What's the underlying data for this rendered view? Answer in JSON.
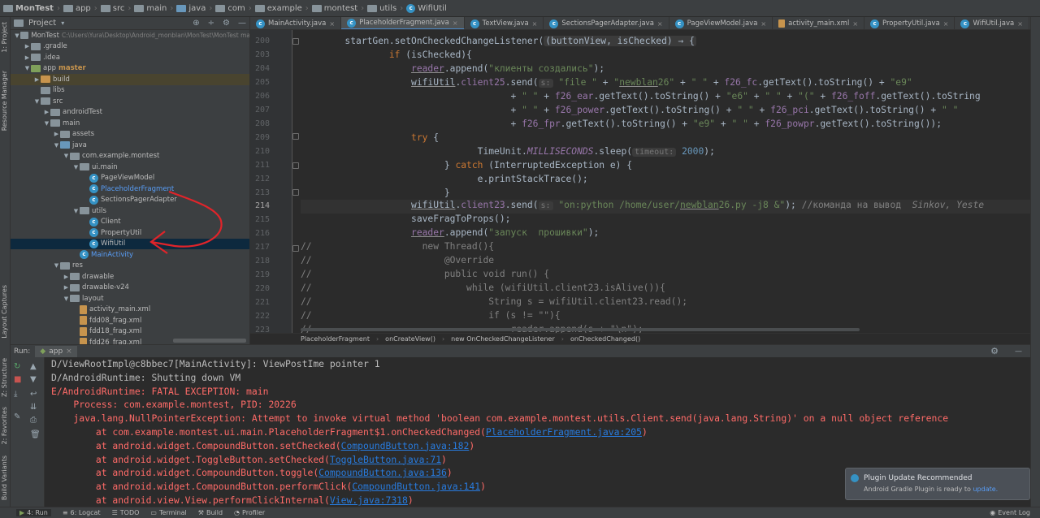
{
  "breadcrumb": [
    "MonTest",
    "app",
    "src",
    "main",
    "java",
    "com",
    "example",
    "montest",
    "utils",
    "WifiUtil"
  ],
  "project_panel": {
    "title": "Project",
    "tree": [
      {
        "label": "MonTest",
        "extra": "C:\\Users\\Yura\\Desktop\\Android_monblan\\MonTest\\MonTest  ma",
        "indent": 0,
        "icon": "folder",
        "arrow": "open"
      },
      {
        "label": ".gradle",
        "indent": 1,
        "icon": "folder",
        "arrow": "closed"
      },
      {
        "label": ".idea",
        "indent": 1,
        "icon": "folder",
        "arrow": "closed"
      },
      {
        "label": "app",
        "extra": "master",
        "indent": 1,
        "icon": "folder-green",
        "arrow": "open"
      },
      {
        "label": "build",
        "indent": 2,
        "icon": "folder-orange",
        "arrow": "closed",
        "highlight": true
      },
      {
        "label": "libs",
        "indent": 2,
        "icon": "folder",
        "arrow": "none"
      },
      {
        "label": "src",
        "indent": 2,
        "icon": "folder",
        "arrow": "open"
      },
      {
        "label": "androidTest",
        "indent": 3,
        "icon": "folder",
        "arrow": "closed"
      },
      {
        "label": "main",
        "indent": 3,
        "icon": "folder",
        "arrow": "open"
      },
      {
        "label": "assets",
        "indent": 4,
        "icon": "folder",
        "arrow": "closed"
      },
      {
        "label": "java",
        "indent": 4,
        "icon": "folder-blue",
        "arrow": "open"
      },
      {
        "label": "com.example.montest",
        "indent": 5,
        "icon": "folder",
        "arrow": "open"
      },
      {
        "label": "ui.main",
        "indent": 6,
        "icon": "folder",
        "arrow": "open"
      },
      {
        "label": "PageViewModel",
        "indent": 7,
        "icon": "class",
        "arrow": "none"
      },
      {
        "label": "PlaceholderFragment",
        "indent": 7,
        "icon": "class",
        "arrow": "none",
        "color": "blue"
      },
      {
        "label": "SectionsPagerAdapter",
        "indent": 7,
        "icon": "class",
        "arrow": "none"
      },
      {
        "label": "utils",
        "indent": 6,
        "icon": "folder",
        "arrow": "open"
      },
      {
        "label": "Client",
        "indent": 7,
        "icon": "class",
        "arrow": "none"
      },
      {
        "label": "PropertyUtil",
        "indent": 7,
        "icon": "class",
        "arrow": "none"
      },
      {
        "label": "WifiUtil",
        "indent": 7,
        "icon": "class",
        "arrow": "none",
        "selected": true
      },
      {
        "label": "MainActivity",
        "indent": 6,
        "icon": "class",
        "arrow": "none",
        "color": "blue"
      },
      {
        "label": "res",
        "indent": 4,
        "icon": "folder",
        "arrow": "open"
      },
      {
        "label": "drawable",
        "indent": 5,
        "icon": "folder",
        "arrow": "closed"
      },
      {
        "label": "drawable-v24",
        "indent": 5,
        "icon": "folder",
        "arrow": "closed"
      },
      {
        "label": "layout",
        "indent": 5,
        "icon": "folder",
        "arrow": "open"
      },
      {
        "label": "activity_main.xml",
        "indent": 6,
        "icon": "xml",
        "arrow": "none"
      },
      {
        "label": "fdd08_frag.xml",
        "indent": 6,
        "icon": "xml",
        "arrow": "none"
      },
      {
        "label": "fdd18_frag.xml",
        "indent": 6,
        "icon": "xml",
        "arrow": "none"
      },
      {
        "label": "fdd26_frag.xml",
        "indent": 6,
        "icon": "xml",
        "arrow": "none"
      }
    ]
  },
  "left_strip": [
    "1: Project",
    "Resource Manager",
    "Layout Captures",
    "Z: Structure",
    "2: Favorites",
    "Build Variants"
  ],
  "editor_tabs": [
    {
      "label": "MainActivity.java",
      "active": false
    },
    {
      "label": "PlaceholderFragment.java",
      "active": true
    },
    {
      "label": "TextView.java",
      "active": false
    },
    {
      "label": "SectionsPagerAdapter.java",
      "active": false
    },
    {
      "label": "PageViewModel.java",
      "active": false
    },
    {
      "label": "activity_main.xml",
      "active": false
    },
    {
      "label": "PropertyUtil.java",
      "active": false
    },
    {
      "label": "WifiUtil.java",
      "active": false
    },
    {
      "label": "Client.java",
      "active": false
    }
  ],
  "editor": {
    "line_numbers": [
      "199",
      "200",
      "203",
      "204",
      "205",
      "206",
      "207",
      "208",
      "209",
      "210",
      "211",
      "212",
      "213",
      "214",
      "215",
      "216",
      "217",
      "218",
      "219",
      "220",
      "221",
      "222",
      "223"
    ],
    "current_line": "214"
  },
  "editor_breadcrumb": [
    "PlaceholderFragment",
    "onCreateView()",
    "new OnCheckedChangeListener",
    "onCheckedChanged()"
  ],
  "run_panel": {
    "label": "Run:",
    "tab": "app",
    "lines": [
      {
        "text": "D/ViewRootImpl@c8bbec7[MainActivity]: ViewPostIme pointer 1",
        "error": false
      },
      {
        "text": "D/AndroidRuntime: Shutting down VM",
        "error": false
      },
      {
        "text": "E/AndroidRuntime: FATAL EXCEPTION: main",
        "error": true
      },
      {
        "text": "    Process: com.example.montest, PID: 20226",
        "error": true
      },
      {
        "text": "    java.lang.NullPointerException: Attempt to invoke virtual method 'boolean com.example.montest.utils.Client.send(java.lang.String)' on a null object reference",
        "error": true
      },
      {
        "text": "        at com.example.montest.ui.main.PlaceholderFragment$1.onCheckedChanged(",
        "link": "PlaceholderFragment.java:205",
        "after": ")",
        "error": true
      },
      {
        "text": "        at android.widget.CompoundButton.setChecked(",
        "link": "CompoundButton.java:182",
        "after": ")",
        "error": true
      },
      {
        "text": "        at android.widget.ToggleButton.setChecked(",
        "link": "ToggleButton.java:71",
        "after": ")",
        "error": true
      },
      {
        "text": "        at android.widget.CompoundButton.toggle(",
        "link": "CompoundButton.java:136",
        "after": ")",
        "error": true
      },
      {
        "text": "        at android.widget.CompoundButton.performClick(",
        "link": "CompoundButton.java:141",
        "after": ")",
        "error": true
      },
      {
        "text": "        at android.view.View.performClickInternal(",
        "link": "View.java:7318",
        "after": ")",
        "error": true
      }
    ]
  },
  "notification": {
    "title": "Plugin Update Recommended",
    "text": "Android Gradle Plugin is ready to ",
    "link": "update."
  },
  "status_bar": {
    "items": [
      "4: Run",
      "6: Logcat",
      "TODO",
      "Terminal",
      "Build",
      "Profiler"
    ],
    "event_log": "Event Log"
  },
  "colors": {
    "keyword": "#cc7832",
    "string": "#6a8759",
    "field": "#9876aa",
    "error": "#ff6b68",
    "link": "#287bde",
    "annotation_red": "#e0242a"
  }
}
